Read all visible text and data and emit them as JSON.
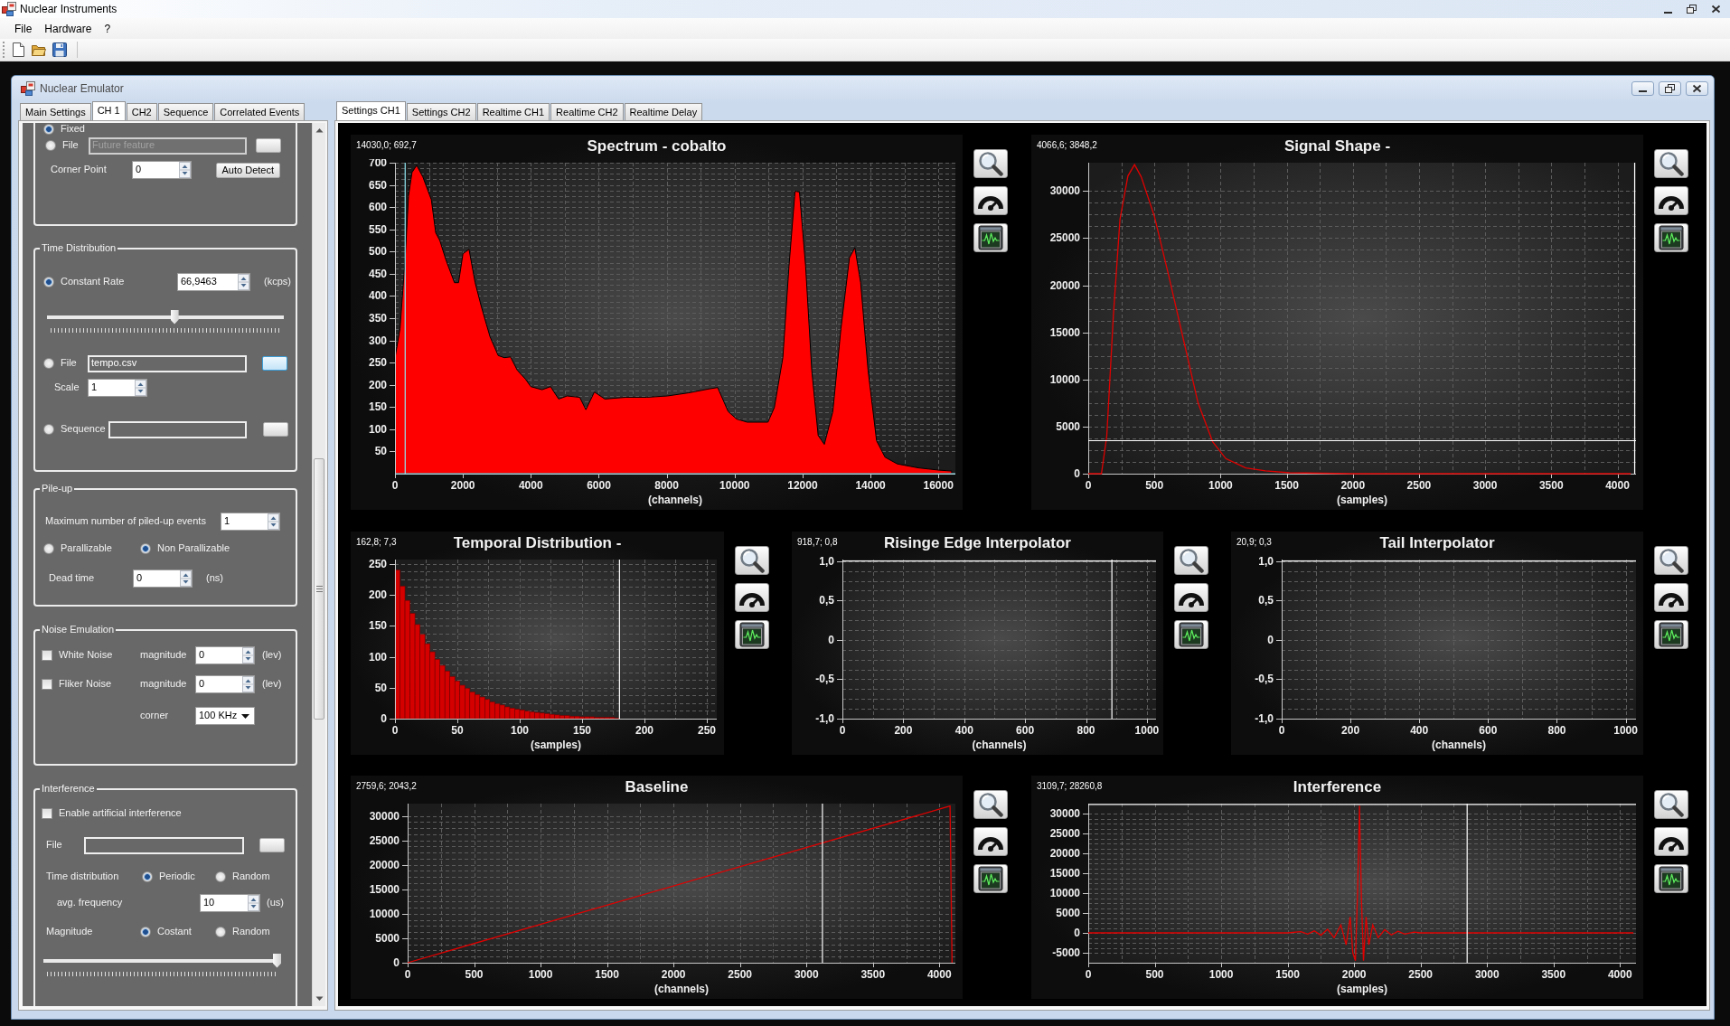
{
  "app_window": {
    "title": "Nuclear Instruments"
  },
  "menu": [
    "File",
    "Hardware",
    "?"
  ],
  "emulator_window": {
    "title": "Nuclear Emulator"
  },
  "settings_tabs": [
    {
      "label": "Main Settings",
      "selected": false
    },
    {
      "label": "CH 1",
      "selected": true
    },
    {
      "label": "CH2",
      "selected": false
    },
    {
      "label": "Sequence",
      "selected": false
    },
    {
      "label": "Correlated Events",
      "selected": false
    }
  ],
  "settings_panel": {
    "groups": [
      {
        "rows": [
          [
            {
              "kind": "radio",
              "label": "Fixed",
              "selected": true
            }
          ],
          [
            {
              "kind": "radio",
              "label": "File",
              "selected": false
            },
            {
              "kind": "field",
              "value": "Future feature",
              "disabled": true
            },
            {
              "kind": "button",
              "hovered": false
            }
          ],
          [
            {
              "kind": "label",
              "text": "Corner Point"
            },
            {
              "kind": "spinner",
              "value": "0"
            },
            {
              "kind": "button",
              "label": "Auto Detect",
              "hovered": false
            }
          ]
        ]
      },
      {
        "title": "Time Distribution",
        "rows": [
          [
            {
              "kind": "radio",
              "label": "Constant Rate",
              "selected": true
            },
            {
              "kind": "spinner",
              "value": "66,9463"
            },
            {
              "kind": "unit",
              "text": "(kcps)"
            }
          ],
          [
            {
              "kind": "slider",
              "level": 0.54
            }
          ],
          [
            {
              "kind": "radio",
              "label": "File",
              "selected": false
            },
            {
              "kind": "field",
              "value": "tempo.csv",
              "disabled": false
            },
            {
              "kind": "button",
              "hovered": true
            }
          ],
          [
            {
              "kind": "label",
              "text": "Scale"
            },
            {
              "kind": "spinner",
              "value": "1"
            }
          ],
          [
            {
              "kind": "radio",
              "label": "Sequence",
              "selected": false
            },
            {
              "kind": "field",
              "disabled": false
            },
            {
              "kind": "button",
              "hovered": false
            }
          ]
        ]
      },
      {
        "title": "Pile-up",
        "rows": [
          [
            {
              "kind": "label",
              "text": "Maximum number of piled-up events"
            },
            {
              "kind": "spinner",
              "value": "1"
            }
          ],
          [
            {
              "kind": "radio",
              "label": "Parallizable",
              "selected": false
            },
            {
              "kind": "radio",
              "label": "Non Parallizable",
              "selected": true
            }
          ],
          [
            {
              "kind": "label",
              "text": "Dead time"
            },
            {
              "kind": "spinner",
              "value": "0"
            },
            {
              "kind": "unit",
              "text": "(ns)"
            }
          ]
        ]
      },
      {
        "title": "Noise Emulation",
        "rows": [
          [
            {
              "kind": "checkbox",
              "label": "White Noise",
              "checked": false
            },
            {
              "kind": "label",
              "text": "magnitude"
            },
            {
              "kind": "spinner",
              "value": "0"
            },
            {
              "kind": "unit",
              "text": "(lev)"
            }
          ],
          [
            {
              "kind": "checkbox",
              "label": "Fliker Noise",
              "checked": false
            },
            {
              "kind": "label",
              "text": "magnitude"
            },
            {
              "kind": "spinner",
              "value": "0"
            },
            {
              "kind": "unit",
              "text": "(lev)"
            }
          ],
          [
            "",
            {
              "kind": "label",
              "text": "corner"
            },
            {
              "kind": "dropdown",
              "value": "100 KHz"
            }
          ]
        ]
      },
      {
        "title": "Interference",
        "rows": [
          [
            {
              "kind": "checkbox",
              "label": "Enable artificial interference",
              "checked": false
            }
          ],
          [
            {
              "kind": "label",
              "text": "File"
            },
            {
              "kind": "field",
              "disabled": false
            },
            {
              "kind": "button",
              "hovered": false
            }
          ],
          [
            {
              "kind": "label",
              "text": "Time distribution"
            },
            {
              "kind": "radio",
              "label": "Periodic",
              "selected": true
            },
            {
              "kind": "radio",
              "label": "Random",
              "selected": false
            }
          ],
          [
            {
              "kind": "label",
              "text": "avg. frequency"
            },
            {
              "kind": "spinner",
              "value": "10"
            },
            {
              "kind": "unit",
              "text": "(us)"
            }
          ],
          [
            {
              "kind": "label",
              "text": "Magnitude"
            },
            {
              "kind": "radio",
              "label": "Costant",
              "selected": true
            },
            {
              "kind": "radio",
              "label": "Random",
              "selected": false
            }
          ],
          [
            {
              "kind": "slider",
              "level": 1
            }
          ]
        ]
      }
    ]
  },
  "chart_tabs": [
    {
      "label": "Settings CH1",
      "selected": true
    },
    {
      "label": "Settings CH2",
      "selected": false
    },
    {
      "label": "Realtime CH1",
      "selected": false
    },
    {
      "label": "Realtime CH2",
      "selected": false
    },
    {
      "label": "Realtime Delay",
      "selected": false
    }
  ],
  "charts": [
    {
      "readout": "14030,0; 692,7",
      "chart_data": {
        "type": "area",
        "title": "Spectrum - cobalto",
        "xlabel": "(channels)",
        "x": [
          0,
          150,
          300,
          400,
          500,
          640,
          820,
          1070,
          1200,
          1320,
          1500,
          1750,
          1870,
          2000,
          2180,
          2360,
          2550,
          2800,
          3040,
          3220,
          3400,
          3600,
          3840,
          4000,
          4330,
          4580,
          4820,
          5070,
          5440,
          5620,
          5870,
          6180,
          6790,
          7410,
          8020,
          8640,
          9260,
          9500,
          9810,
          10060,
          10370,
          10980,
          11170,
          11420,
          11600,
          11780,
          11910,
          12090,
          12270,
          12460,
          12640,
          12890,
          13130,
          13380,
          13540,
          13710,
          13930,
          14180,
          14430,
          14790,
          15410,
          16020,
          16390
        ],
        "series": [
          {
            "color": "#ff0000",
            "values": [
              260,
              327,
              486,
              626,
              678,
              694,
              668,
              617,
              542,
              525,
              481,
              430,
              430,
              495,
              505,
              430,
              374,
              308,
              266,
              261,
              263,
              233,
              213,
              196,
              189,
              196,
              168,
              175,
              172,
              144,
              184,
              168,
              172,
              172,
              175,
              182,
              191,
              194,
              140,
              123,
              116,
              116,
              149,
              261,
              467,
              636,
              634,
              467,
              233,
              86,
              66,
              140,
              327,
              486,
              509,
              430,
              233,
              74,
              37,
              22,
              13,
              8,
              6
            ]
          }
        ],
        "xlim": [
          0,
          16500
        ],
        "ylim": [
          0,
          700
        ],
        "xticks": [
          0,
          2000,
          4000,
          6000,
          8000,
          10000,
          12000,
          14000,
          16000
        ],
        "yticks": [
          50,
          100,
          150,
          200,
          250,
          300,
          350,
          400,
          450,
          500,
          550,
          600,
          650,
          700
        ],
        "grid": true,
        "ref_lines": [
          {
            "axis": "x",
            "value": 300,
            "color": "#8fe6f2"
          },
          {
            "axis": "y",
            "value": 0,
            "color": "#8fe6f2"
          }
        ]
      }
    },
    {
      "readout": "4066,6; 3848,2",
      "chart_data": {
        "type": "line",
        "title": "Signal Shape -",
        "xlabel": "(samples)",
        "x": [
          0,
          100,
          140,
          190,
          240,
          300,
          350,
          400,
          500,
          610,
          720,
          830,
          940,
          1040,
          1190,
          1340,
          1520,
          2000,
          3000,
          4100
        ],
        "series": [
          {
            "color": "#e00000",
            "values": [
              0,
              0,
              4000,
              16800,
              27000,
              31600,
              32800,
              31500,
              27300,
              20900,
              14200,
              7500,
              3400,
              1600,
              600,
              300,
              100,
              0,
              0,
              0
            ]
          }
        ],
        "xlim": [
          0,
          4140
        ],
        "ylim": [
          0,
          33000
        ],
        "xticks": [
          0,
          500,
          1000,
          1500,
          2000,
          2500,
          3000,
          3500,
          4000
        ],
        "yticks": [
          0,
          5000,
          10000,
          15000,
          20000,
          25000,
          30000
        ],
        "grid": true,
        "ref_lines": [
          {
            "axis": "x",
            "value": 4130,
            "color": "#ffffff"
          },
          {
            "axis": "y",
            "value": 3500,
            "color": "#ffffff"
          }
        ]
      }
    },
    {
      "readout": "162,8; 7,3",
      "chart_data": {
        "type": "bar",
        "title": "Temporal Distribution -",
        "xlabel": "(samples)",
        "x": [
          0,
          4,
          8,
          12,
          16,
          20,
          24,
          28,
          32,
          36,
          40,
          44,
          48,
          52,
          56,
          60,
          64,
          68,
          72,
          76,
          80,
          84,
          88,
          92,
          96,
          100,
          104,
          108,
          112,
          116,
          120,
          124,
          128,
          132,
          136,
          140,
          144,
          148,
          152,
          156,
          160,
          164,
          168,
          172,
          176
        ],
        "series": [
          {
            "color": "#d40000",
            "values": [
              240,
              214,
              191,
              170,
              152,
              136,
              121,
              108,
              96,
              86,
              77,
              68,
              61,
              54,
              49,
              43,
              39,
              35,
              31,
              27,
              24,
              22,
              19,
              17,
              15,
              14,
              12,
              11,
              10,
              9,
              8,
              7,
              6,
              5,
              5,
              4,
              4,
              3,
              3,
              3,
              2,
              2,
              2,
              2,
              1
            ]
          }
        ],
        "xlim": [
          0,
          258
        ],
        "ylim": [
          0,
          257
        ],
        "xticks": [
          0,
          50,
          100,
          150,
          200,
          250
        ],
        "yticks": [
          0,
          50,
          100,
          150,
          200,
          250
        ],
        "grid": true,
        "ref_lines": [
          {
            "axis": "x",
            "value": 180,
            "color": "#ffffff"
          }
        ]
      }
    },
    {
      "readout": "918,7; 0,8",
      "chart_data": {
        "type": "line",
        "title": "Risinge Edge Interpolator",
        "xlabel": "(channels)",
        "x": [
          0,
          1030
        ],
        "series": [
          {
            "color": "#ffffff",
            "values": [
              1,
              1
            ]
          }
        ],
        "xlim": [
          0,
          1030
        ],
        "ylim": [
          -1,
          1.02
        ],
        "xticks": [
          0,
          200,
          400,
          600,
          800,
          1000
        ],
        "yticks": [
          {
            "value": -1,
            "label": "-1,0"
          },
          {
            "value": -0.5,
            "label": "-0,5"
          },
          0,
          {
            "value": 0.5,
            "label": "0,5"
          },
          {
            "value": 1,
            "label": "1,0"
          }
        ],
        "grid": true,
        "ref_lines": [
          {
            "axis": "x",
            "value": 885,
            "color": "#ffffff"
          }
        ]
      }
    },
    {
      "readout": "20,9; 0,3",
      "chart_data": {
        "type": "line",
        "title": "Tail Interpolator",
        "xlabel": "(channels)",
        "x": [
          0,
          1030
        ],
        "series": [
          {
            "color": "#ffffff",
            "values": [
              1,
              1
            ]
          }
        ],
        "xlim": [
          0,
          1030
        ],
        "ylim": [
          -1,
          1.02
        ],
        "xticks": [
          0,
          200,
          400,
          600,
          800,
          1000
        ],
        "yticks": [
          {
            "value": -1,
            "label": "-1,0"
          },
          {
            "value": -0.5,
            "label": "-0,5"
          },
          0,
          {
            "value": 0.5,
            "label": "0,5"
          },
          {
            "value": 1,
            "label": "1,0"
          }
        ],
        "grid": true
      }
    },
    {
      "readout": "2759,6; 2043,2",
      "chart_data": {
        "type": "line",
        "title": "Baseline",
        "xlabel": "(channels)",
        "x": [
          0,
          4080,
          4095
        ],
        "series": [
          {
            "color": "#e00000",
            "values": [
              0,
              32000,
              0
            ]
          }
        ],
        "xlim": [
          0,
          4120
        ],
        "ylim": [
          0,
          32500
        ],
        "xticks": [
          0,
          500,
          1000,
          1500,
          2000,
          2500,
          3000,
          3500,
          4000
        ],
        "yticks": [
          0,
          5000,
          10000,
          15000,
          20000,
          25000,
          30000
        ],
        "grid": true,
        "ref_lines": [
          {
            "axis": "x",
            "value": 3120,
            "color": "#ffffff"
          }
        ]
      }
    },
    {
      "readout": "3109,7; 28260,8",
      "chart_data": {
        "type": "line",
        "title": "Interference",
        "xlabel": "(samples)",
        "x": [
          0,
          1500,
          1600,
          1650,
          1700,
          1750,
          1800,
          1850,
          1900,
          1940,
          1970,
          1990,
          2010,
          2025,
          2040,
          2055,
          2070,
          2090,
          2110,
          2140,
          2180,
          2230,
          2280,
          2330,
          2380,
          2450,
          2500,
          4100
        ],
        "series": [
          {
            "color": "#e00000",
            "values": [
              0,
              0,
              300,
              -300,
              500,
              -600,
              900,
              -1200,
              2000,
              -3000,
              4000,
              -5000,
              -7000,
              10000,
              32000,
              8000,
              -7000,
              4000,
              -3000,
              2000,
              -1200,
              800,
              -500,
              400,
              -300,
              200,
              0,
              0
            ]
          }
        ],
        "xlim": [
          0,
          4120
        ],
        "ylim": [
          -7500,
          32500
        ],
        "xticks": [
          0,
          500,
          1000,
          1500,
          2000,
          2500,
          3000,
          3500,
          4000
        ],
        "yticks": [
          -5000,
          0,
          5000,
          10000,
          15000,
          20000,
          25000,
          30000
        ],
        "grid": true,
        "ref_lines": [
          {
            "axis": "x",
            "value": 2850,
            "color": "#ffffff"
          },
          {
            "axis": "y",
            "value": 32300,
            "color": "#ffffff"
          }
        ]
      }
    }
  ]
}
